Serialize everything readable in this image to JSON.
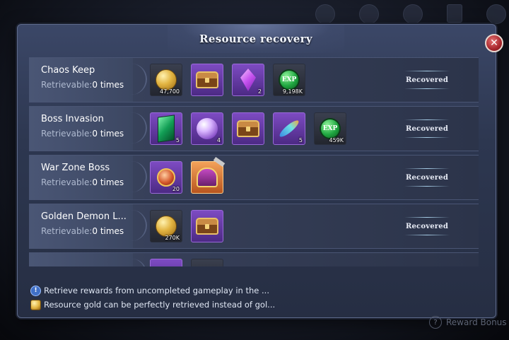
{
  "dialog": {
    "title": "Resource recovery",
    "close_label": "✕"
  },
  "rows": [
    {
      "name": "Chaos Keep",
      "retrievable_label": "Retrievable:",
      "retrievable_value": "0 times",
      "status": "Recovered",
      "items": [
        {
          "icon": "gold-coin-icon",
          "quality": "dark",
          "count": "47,700"
        },
        {
          "icon": "treasure-chest-icon",
          "quality": "purple",
          "count": ""
        },
        {
          "icon": "purple-crystal-icon",
          "quality": "purple",
          "count": "2"
        },
        {
          "icon": "exp-orb-icon",
          "quality": "dark",
          "count": "9,198K",
          "text": "EXP"
        }
      ]
    },
    {
      "name": "Boss Invasion",
      "retrievable_label": "Retrievable:",
      "retrievable_value": "0 times",
      "status": "Recovered",
      "items": [
        {
          "icon": "green-gem-icon",
          "quality": "purple",
          "count": "5"
        },
        {
          "icon": "crystal-orb-icon",
          "quality": "purple",
          "count": "4"
        },
        {
          "icon": "treasure-chest-icon",
          "quality": "purple",
          "count": ""
        },
        {
          "icon": "feather-icon",
          "quality": "purple",
          "count": "5"
        },
        {
          "icon": "exp-orb-icon",
          "quality": "dark",
          "count": "459K",
          "text": "EXP"
        }
      ]
    },
    {
      "name": "War Zone Boss",
      "retrievable_label": "Retrievable:",
      "retrievable_value": "0 times",
      "status": "Recovered",
      "items": [
        {
          "icon": "medal-icon",
          "quality": "purple",
          "count": "20"
        },
        {
          "icon": "helmet-icon",
          "quality": "orange",
          "count": ""
        }
      ]
    },
    {
      "name": "Golden Demon L...",
      "retrievable_label": "Retrievable:",
      "retrievable_value": "0 times",
      "status": "Recovered",
      "items": [
        {
          "icon": "gold-coin-icon",
          "quality": "dark",
          "count": "270K"
        },
        {
          "icon": "treasure-chest-icon",
          "quality": "purple",
          "count": ""
        }
      ]
    }
  ],
  "footer": {
    "tip_info": "Retrieve rewards from uncompleted gameplay in the ...",
    "tip_gold": "Resource gold can be perfectly retrieved instead of gol..."
  },
  "reward_bonus": {
    "label": "Reward Bonus",
    "icon": "question-icon"
  }
}
